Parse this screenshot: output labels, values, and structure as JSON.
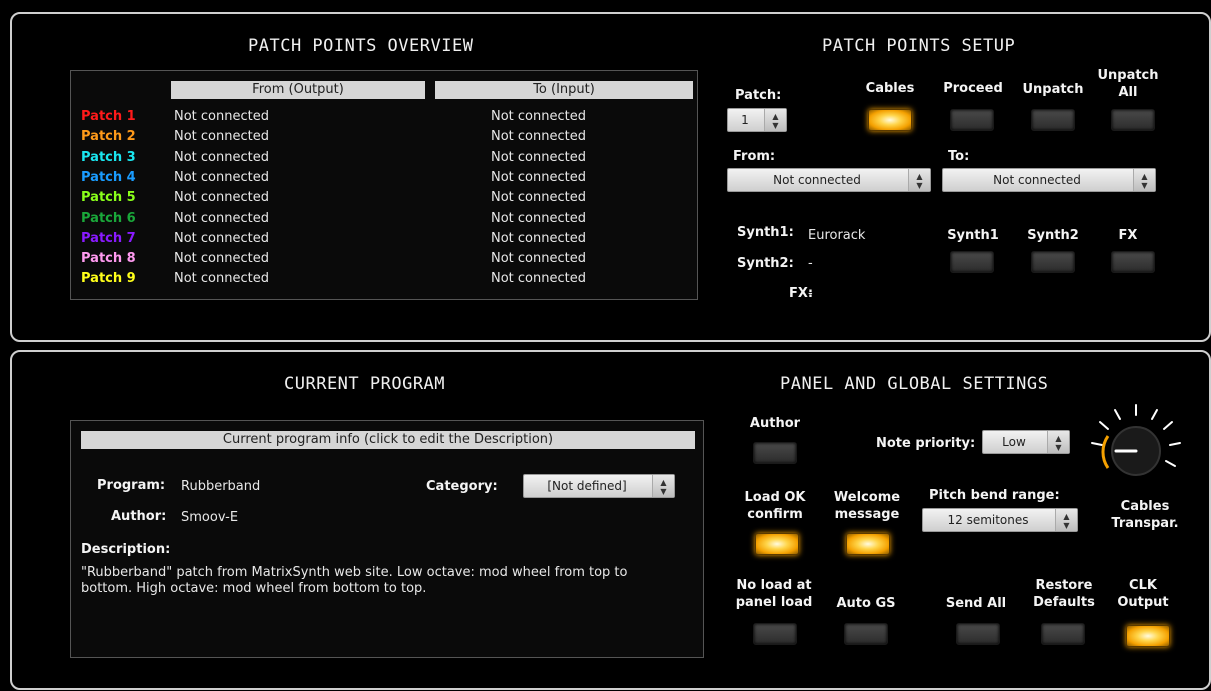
{
  "patch_overview": {
    "title": "PATCH POINTS OVERVIEW",
    "col_from": "From (Output)",
    "col_to": "To (Input)",
    "rows": [
      {
        "name": "Patch 1",
        "color": "#ff1a1a",
        "from": "Not connected",
        "to": "Not connected"
      },
      {
        "name": "Patch 2",
        "color": "#ff9a1a",
        "from": "Not connected",
        "to": "Not connected"
      },
      {
        "name": "Patch 3",
        "color": "#1ae6f0",
        "from": "Not connected",
        "to": "Not connected"
      },
      {
        "name": "Patch 4",
        "color": "#1a9cff",
        "from": "Not connected",
        "to": "Not connected"
      },
      {
        "name": "Patch 5",
        "color": "#8aff1a",
        "from": "Not connected",
        "to": "Not connected"
      },
      {
        "name": "Patch 6",
        "color": "#1aa83a",
        "from": "Not connected",
        "to": "Not connected"
      },
      {
        "name": "Patch 7",
        "color": "#8a1aff",
        "from": "Not connected",
        "to": "Not connected"
      },
      {
        "name": "Patch 8",
        "color": "#ff9af0",
        "from": "Not connected",
        "to": "Not connected"
      },
      {
        "name": "Patch 9",
        "color": "#ffff1a",
        "from": "Not connected",
        "to": "Not connected"
      }
    ]
  },
  "patch_setup": {
    "title": "PATCH POINTS SETUP",
    "patch_label": "Patch:",
    "patch_value": "1",
    "cables_label": "Cables",
    "proceed_label": "Proceed",
    "unpatch_label": "Unpatch",
    "unpatch_all_label": "Unpatch\nAll",
    "from_label": "From:",
    "from_value": "Not connected",
    "to_label": "To:",
    "to_value": "Not connected",
    "synth1_label": "Synth1:",
    "synth1_value": "Eurorack",
    "synth2_label": "Synth2:",
    "synth2_value": "-",
    "fx_label": "FX:",
    "fx_value": "-",
    "btn_synth1": "Synth1",
    "btn_synth2": "Synth2",
    "btn_fx": "FX"
  },
  "current_program": {
    "title": "CURRENT PROGRAM",
    "info_header": "Current program info (click to edit the Description)",
    "program_label": "Program:",
    "program_value": "Rubberband",
    "author_label": "Author:",
    "author_value": "Smoov-E",
    "category_label": "Category:",
    "category_value": "[Not defined]",
    "description_label": "Description:",
    "description_text": "\"Rubberband\" patch from MatrixSynth web site.  Low octave: mod wheel from top to bottom. High octave: mod wheel from bottom to top."
  },
  "global_settings": {
    "title": "PANEL AND GLOBAL SETTINGS",
    "author_label": "Author",
    "note_priority_label": "Note priority:",
    "note_priority_value": "Low",
    "load_ok_label": "Load OK\nconfirm",
    "welcome_label": "Welcome\nmessage",
    "pitch_bend_label": "Pitch bend range:",
    "pitch_bend_value": "12 semitones",
    "cables_transpar_label": "Cables\nTranspar.",
    "no_load_label": "No load at\npanel load",
    "auto_gs_label": "Auto GS",
    "send_all_label": "Send All",
    "restore_label": "Restore\nDefaults",
    "clk_label": "CLK\nOutput"
  },
  "led_states": {
    "cables": true,
    "proceed": false,
    "unpatch": false,
    "unpatch_all": false,
    "synth1": false,
    "synth2": false,
    "fx": false,
    "author": false,
    "load_ok": true,
    "welcome": true,
    "no_load": false,
    "auto_gs": false,
    "send_all": false,
    "restore": false,
    "clk": true
  },
  "colors": {
    "led_on": "#f4a000",
    "knob_arc": "#f4a000"
  }
}
